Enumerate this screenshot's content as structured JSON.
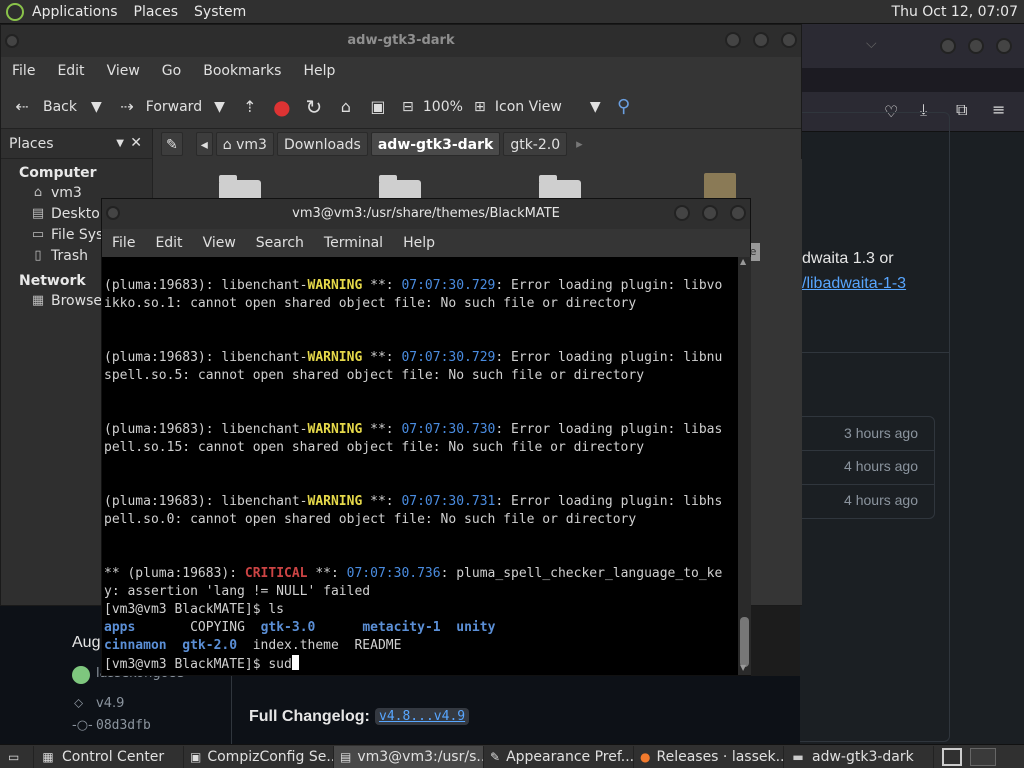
{
  "top_panel": {
    "menus": [
      "Applications",
      "Places",
      "System"
    ],
    "clock": "Thu Oct 12, 07:07"
  },
  "file_manager": {
    "title": "adw-gtk3-dark",
    "menu": [
      "File",
      "Edit",
      "View",
      "Go",
      "Bookmarks",
      "Help"
    ],
    "toolbar": {
      "back": "Back",
      "forward": "Forward",
      "zoom": "100%",
      "view_mode": "Icon View"
    },
    "places_label": "Places",
    "breadcrumbs": [
      "vm3",
      "Downloads",
      "adw-gtk3-dark",
      "gtk-2.0"
    ],
    "active_crumb": "adw-gtk3-dark",
    "sidebar": {
      "computer_label": "Computer",
      "computer_items": [
        {
          "label": "vm3",
          "icon": "home-icon"
        },
        {
          "label": "Desktop",
          "icon": "desktop-icon"
        },
        {
          "label": "File Syst",
          "icon": "drive-icon"
        },
        {
          "label": "Trash",
          "icon": "trash-icon"
        }
      ],
      "network_label": "Network",
      "network_items": [
        {
          "label": "Browse N",
          "icon": "network-icon"
        }
      ]
    }
  },
  "terminal": {
    "title": "vm3@vm3:/usr/share/themes/BlackMATE",
    "menu": [
      "File",
      "Edit",
      "View",
      "Search",
      "Terminal",
      "Help"
    ],
    "warnings": [
      {
        "prefix": "(pluma:19683): libenchant-",
        "level": "WARNING",
        "stars": " **: ",
        "time": "07:07:30.729",
        "msg": ": Error loading plugin: libvo",
        "cont": "ikko.so.1: cannot open shared object file: No such file or directory"
      },
      {
        "prefix": "(pluma:19683): libenchant-",
        "level": "WARNING",
        "stars": " **: ",
        "time": "07:07:30.729",
        "msg": ": Error loading plugin: libnu",
        "cont": "spell.so.5: cannot open shared object file: No such file or directory"
      },
      {
        "prefix": "(pluma:19683): libenchant-",
        "level": "WARNING",
        "stars": " **: ",
        "time": "07:07:30.730",
        "msg": ": Error loading plugin: libas",
        "cont": "pell.so.15: cannot open shared object file: No such file or directory"
      },
      {
        "prefix": "(pluma:19683): libenchant-",
        "level": "WARNING",
        "stars": " **: ",
        "time": "07:07:30.731",
        "msg": ": Error loading plugin: libhs",
        "cont": "pell.so.0: cannot open shared object file: No such file or directory"
      }
    ],
    "critical": {
      "prefix": "** (pluma:19683): ",
      "level": "CRITICAL",
      "stars": " **: ",
      "time": "07:07:30.736",
      "msg": ": pluma_spell_checker_language_to_ke",
      "cont": "y: assertion 'lang != NULL' failed"
    },
    "prompt1": "[vm3@vm3 BlackMATE]$ ls",
    "ls_row1": {
      "a": "apps",
      "b": "COPYING",
      "c": "gtk-3.0",
      "d": "metacity-1",
      "e": "unity"
    },
    "ls_row2": {
      "a": "cinnamon",
      "b": "gtk-2.0",
      "c": "index.theme",
      "d": "README"
    },
    "prompt2": "[vm3@vm3 BlackMATE]$ sud"
  },
  "browser_bg": {
    "text1": "dwaita 1.3 or",
    "link1": "/libadwaita-1-3",
    "times": [
      "3 hours ago",
      "4 hours ago",
      "4 hours ago"
    ],
    "aug": "Aug",
    "author": "lassekongo83",
    "tag": "v4.9",
    "commit": "08d3dfb",
    "changelog_label": "Full Changelog:",
    "changelog_link": "v4.8...v4.9"
  },
  "taskbar": [
    {
      "label": "Control Center",
      "icon": "control-center-icon"
    },
    {
      "label": "CompizConfig Se...",
      "icon": "compiz-icon"
    },
    {
      "label": "vm3@vm3:/usr/s...",
      "icon": "terminal-icon",
      "active": true
    },
    {
      "label": "Appearance Pref...",
      "icon": "appearance-icon"
    },
    {
      "label": "Releases · lassek...",
      "icon": "firefox-icon"
    },
    {
      "label": "adw-gtk3-dark",
      "icon": "folder-icon"
    }
  ]
}
